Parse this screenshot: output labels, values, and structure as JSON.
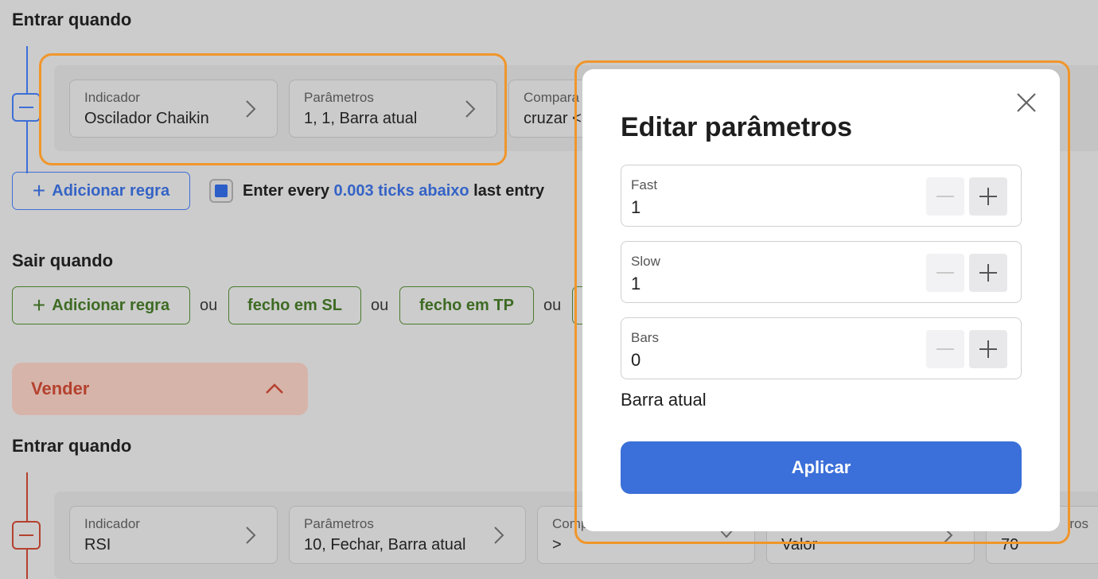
{
  "buy_section": {
    "enter_heading": "Entrar quando",
    "rule": {
      "indicator_label": "Indicador",
      "indicator_value": "Oscilador Chaikin",
      "params_label": "Parâmetros",
      "params_value": "1, 1, Barra atual",
      "compare_label": "Compara",
      "compare_value": "cruzar <"
    },
    "add_rule": "Adicionar regra",
    "entry_every": {
      "checked": true,
      "prefix": "Enter every ",
      "link": "0.003 ticks abaixo",
      "suffix": " last entry"
    },
    "exit_heading": "Sair quando",
    "exit_add_rule": "Adicionar regra",
    "or_text": "ou",
    "exit_sl": "fecho em SL",
    "exit_tp": "fecho em TP"
  },
  "sell_section": {
    "toggle_label": "Vender",
    "enter_heading": "Entrar quando",
    "rule": {
      "indicator_label": "Indicador",
      "indicator_value": "RSI",
      "params_label": "Parâmetros",
      "params_value": "10, Fechar, Barra atual",
      "compare_label": "Comp",
      "compare_value": ">",
      "value_type": "Valor",
      "value_label": "ros",
      "value_value": "70"
    }
  },
  "modal": {
    "title": "Editar parâmetros",
    "fields": [
      {
        "label": "Fast",
        "value": "1"
      },
      {
        "label": "Slow",
        "value": "1"
      },
      {
        "label": "Bars",
        "value": "0"
      }
    ],
    "bars_hint": "Barra atual",
    "apply_label": "Aplicar"
  },
  "colors": {
    "accent_blue": "#3b6fd9",
    "highlight_orange": "#f0962b",
    "sell_red": "#b4412e",
    "exit_green": "#3d6b23"
  }
}
